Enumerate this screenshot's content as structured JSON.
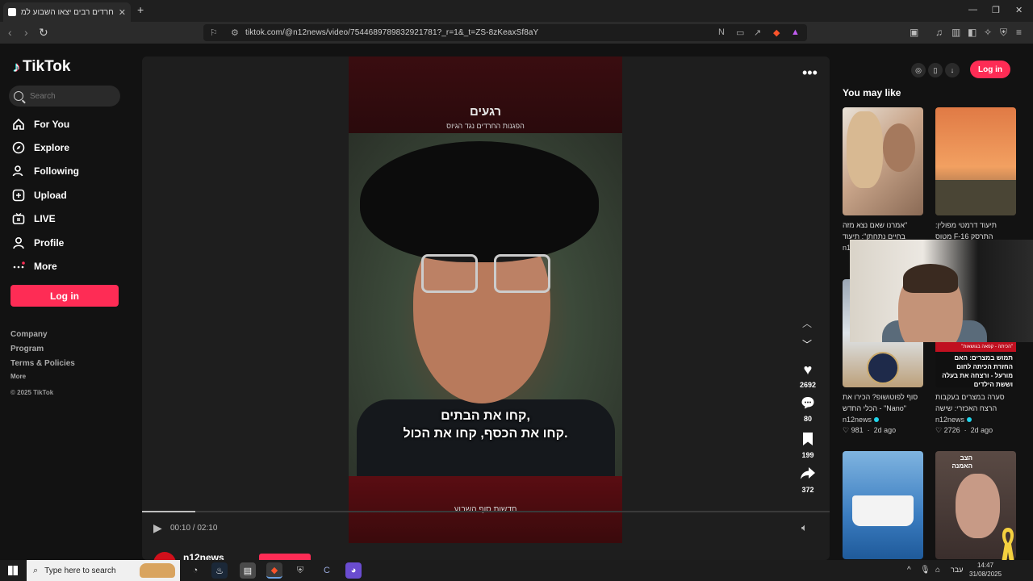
{
  "browser": {
    "tab_title": "חרדים רבים יצאו השבוע למחות :",
    "new_tab": "+",
    "url": "tiktok.com/@n12news/video/7544689789832921781?_r=1&_t=ZS-8zKeaxSf8aY",
    "window_controls": [
      "—",
      "❐",
      "✕"
    ]
  },
  "sidebar": {
    "logo": "TikTok",
    "search_placeholder": "Search",
    "nav": [
      {
        "label": "For You",
        "icon": "home-icon"
      },
      {
        "label": "Explore",
        "icon": "compass-icon"
      },
      {
        "label": "Following",
        "icon": "following-icon"
      },
      {
        "label": "Upload",
        "icon": "upload-icon"
      },
      {
        "label": "LIVE",
        "icon": "live-icon"
      },
      {
        "label": "Profile",
        "icon": "profile-icon"
      },
      {
        "label": "More",
        "icon": "more-icon"
      }
    ],
    "login": "Log in",
    "footer": {
      "company": "Company",
      "program": "Program",
      "terms": "Terms & Policies",
      "more": "More",
      "copyright": "© 2025 TikTok"
    }
  },
  "video": {
    "overlay_logo": "רגעים",
    "overlay_tagline": "הפגנות החרדים נגד הגיוס",
    "subtitle_line1": "קחו את הבתים,",
    "subtitle_line2": "קחו את הכסף, קחו את הכול.",
    "bottom_brand": "חדשות סוף השבוע",
    "time": "00:10 / 02:10",
    "progress": 0.077,
    "author": "n12news"
  },
  "actions": {
    "likes": "2692",
    "comments": "80",
    "saves": "199",
    "shares": "372"
  },
  "right_panel": {
    "login": "Log in",
    "heading": "You may like",
    "cards": [
      {
        "caption": "\"אמרנו שאם נצא מזה בחיים נתחתן\": תיעוד",
        "author": "n12news",
        "likes": "",
        "age": ""
      },
      {
        "caption": "תיעוד דרמטי מפולין: התרסק F-16 מטוס",
        "author": "",
        "likes": "",
        "age": ""
      },
      {
        "caption": "סוף לפוטושופ? הכירו את \"Nano\" - הכלי החדש",
        "author": "n12news",
        "likes": "981",
        "age": "2d ago"
      },
      {
        "caption": "סערה במצרים בעקבות הרצח האכזרי: שישה",
        "author": "n12news",
        "likes": "2726",
        "age": "2d ago"
      },
      {
        "caption": "",
        "author": "",
        "likes": "",
        "age": ""
      },
      {
        "caption": "",
        "author": "",
        "likes": "",
        "age": ""
      }
    ],
    "card4_overlay": "תמוש במצרים: האם החזרת הכיתה לחום מורעל - ורצחה את בעלה וששת הילדים",
    "card4_tag": "\"הכיתה - קפאה בגושאות\"",
    "card6_overlay": "הצב האמנה"
  },
  "taskbar": {
    "search_placeholder": "Type here to search",
    "language": "עבר",
    "time": "14:47",
    "date": "31/08/2025"
  },
  "colors": {
    "accent": "#fe2c55",
    "background": "#121212",
    "verified": "#20d5ec"
  }
}
